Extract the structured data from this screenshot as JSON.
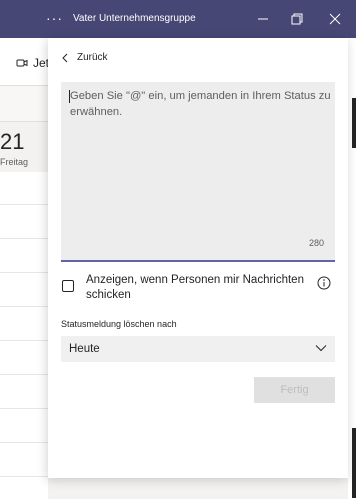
{
  "window": {
    "title": "Vater Unternehmensgruppe",
    "menu_dots": "···"
  },
  "background": {
    "join_label": "Jet",
    "day_number": "21",
    "day_name": "Freitag"
  },
  "panel": {
    "back_label": "Zurück",
    "status_placeholder": "Geben Sie \"@\" ein, um jemanden in Ihrem Status zu erwähnen.",
    "char_counter": "280",
    "show_when_messaging_label": "Anzeigen, wenn Personen mir Nachrichten schicken",
    "show_when_messaging_checked": false,
    "clear_after_label": "Statusmeldung löschen nach",
    "clear_after_value": "Heute",
    "done_label": "Fertig"
  },
  "colors": {
    "titlebar": "#464775",
    "accent": "#6264a7"
  }
}
